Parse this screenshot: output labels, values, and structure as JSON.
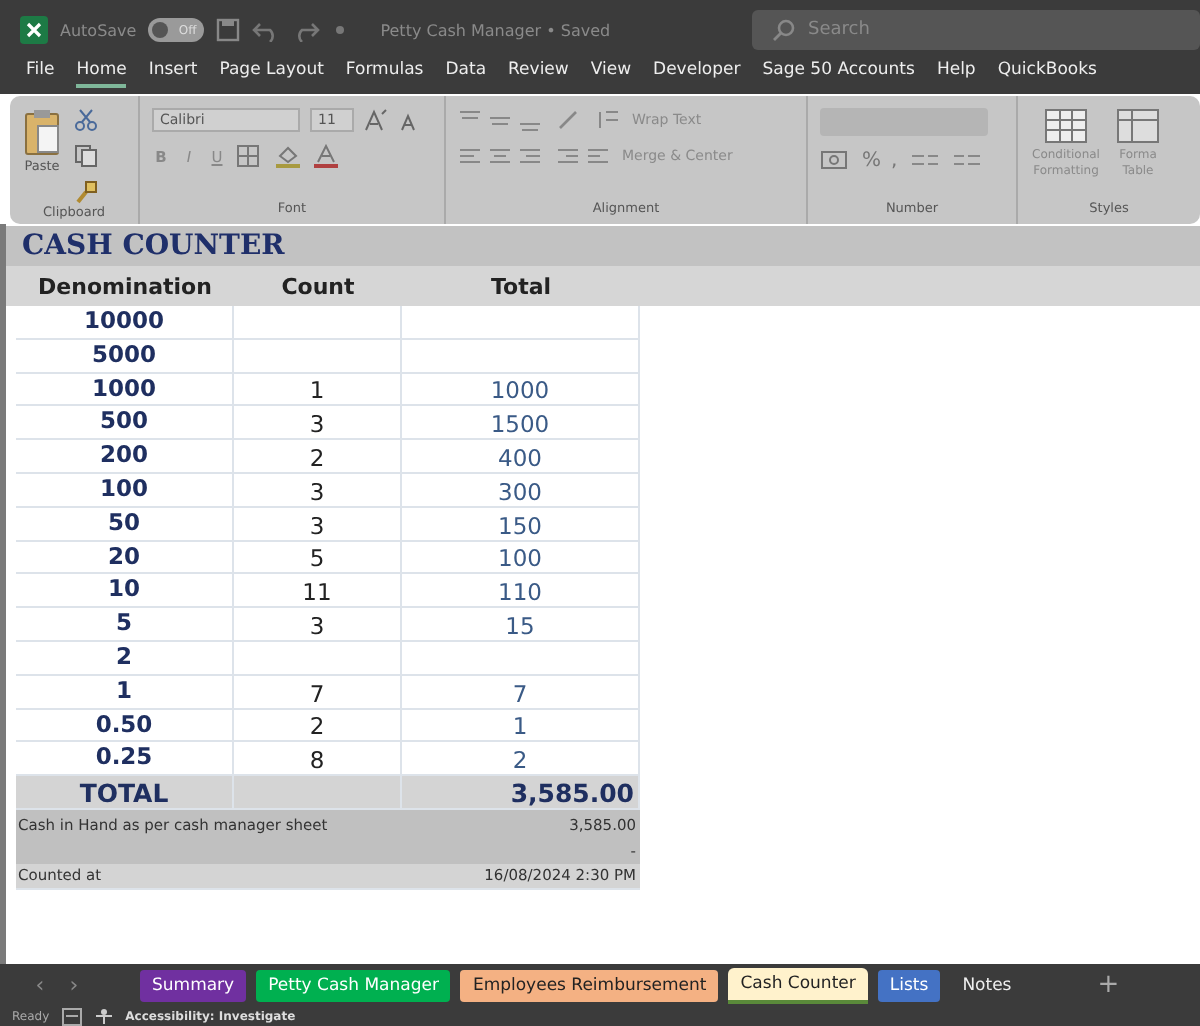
{
  "title_bar": {
    "autosave_label": "AutoSave",
    "autosave_toggle": {
      "label": "Off",
      "on": false
    },
    "title": "Petty Cash Manager • Saved",
    "search": {
      "placeholder": "Search"
    }
  },
  "menu": [
    {
      "label": "File",
      "selected": false
    },
    {
      "label": "Home",
      "selected": true
    },
    {
      "label": "Insert",
      "selected": false
    },
    {
      "label": "Page Layout",
      "selected": false
    },
    {
      "label": "Formulas",
      "selected": false
    },
    {
      "label": "Data",
      "selected": false
    },
    {
      "label": "Review",
      "selected": false
    },
    {
      "label": "View",
      "selected": false
    },
    {
      "label": "Developer",
      "selected": false
    },
    {
      "label": "Sage 50 Accounts",
      "selected": false
    },
    {
      "label": "Help",
      "selected": false
    },
    {
      "label": "QuickBooks",
      "selected": false
    }
  ],
  "ribbon": {
    "paste": "Paste",
    "clipboard": "Clipboard",
    "font_name": "Calibri",
    "font_size": "11",
    "font_buttons": [
      "B",
      "I",
      "U"
    ],
    "font": "Font",
    "wrap_text": "Wrap Text",
    "merge_center": "Merge & Center",
    "alignment": "Alignment",
    "percent": "%",
    "comma": ",",
    "number": "Number",
    "conditional": "Conditional Formatting",
    "format_table": "Forma Table",
    "styles": "Styles"
  },
  "sheet": {
    "title": "CASH COUNTER",
    "columns": [
      "Denomination",
      "Count",
      "Total"
    ],
    "rows": [
      {
        "denomination": "10000",
        "count": "",
        "total": ""
      },
      {
        "denomination": "5000",
        "count": "",
        "total": ""
      },
      {
        "denomination": "1000",
        "count": "1",
        "total": "1000"
      },
      {
        "denomination": "500",
        "count": "3",
        "total": "1500"
      },
      {
        "denomination": "200",
        "count": "2",
        "total": "400"
      },
      {
        "denomination": "100",
        "count": "3",
        "total": "300"
      },
      {
        "denomination": "50",
        "count": "3",
        "total": "150"
      },
      {
        "denomination": "20",
        "count": "5",
        "total": "100"
      },
      {
        "denomination": "10",
        "count": "11",
        "total": "110"
      },
      {
        "denomination": "5",
        "count": "3",
        "total": "15"
      },
      {
        "denomination": "2",
        "count": "",
        "total": ""
      },
      {
        "denomination": "1",
        "count": "7",
        "total": "7"
      },
      {
        "denomination": "0.50",
        "count": "2",
        "total": "1"
      },
      {
        "denomination": "0.25",
        "count": "8",
        "total": "2"
      }
    ],
    "total": {
      "label": "TOTAL",
      "value": "3,585.00"
    },
    "cash_in_hand": {
      "label": "Cash in Hand as per cash manager sheet",
      "value": "3,585.00"
    },
    "difference": {
      "value": "-"
    },
    "counted_at": {
      "label": "Counted at",
      "value": "16/08/2024 2:30 PM"
    }
  },
  "sheet_tabs": [
    {
      "label": "Summary",
      "color": "#7030a0",
      "selected": false
    },
    {
      "label": "Petty Cash Manager",
      "color": "#00b050",
      "selected": false
    },
    {
      "label": "Employees Reimbursement",
      "color": "#f4b183",
      "selected": false
    },
    {
      "label": "Cash  Counter",
      "color": "#fff2cc",
      "selected": true
    },
    {
      "label": "Lists",
      "color": "#4472c4",
      "selected": false
    },
    {
      "label": "Notes",
      "selected": false
    }
  ],
  "sheet_nav": [
    "‹",
    "›"
  ],
  "add_sheet": "+",
  "status_bar": {
    "status": "Ready",
    "accessibility": "Accessibility: Investigate"
  }
}
